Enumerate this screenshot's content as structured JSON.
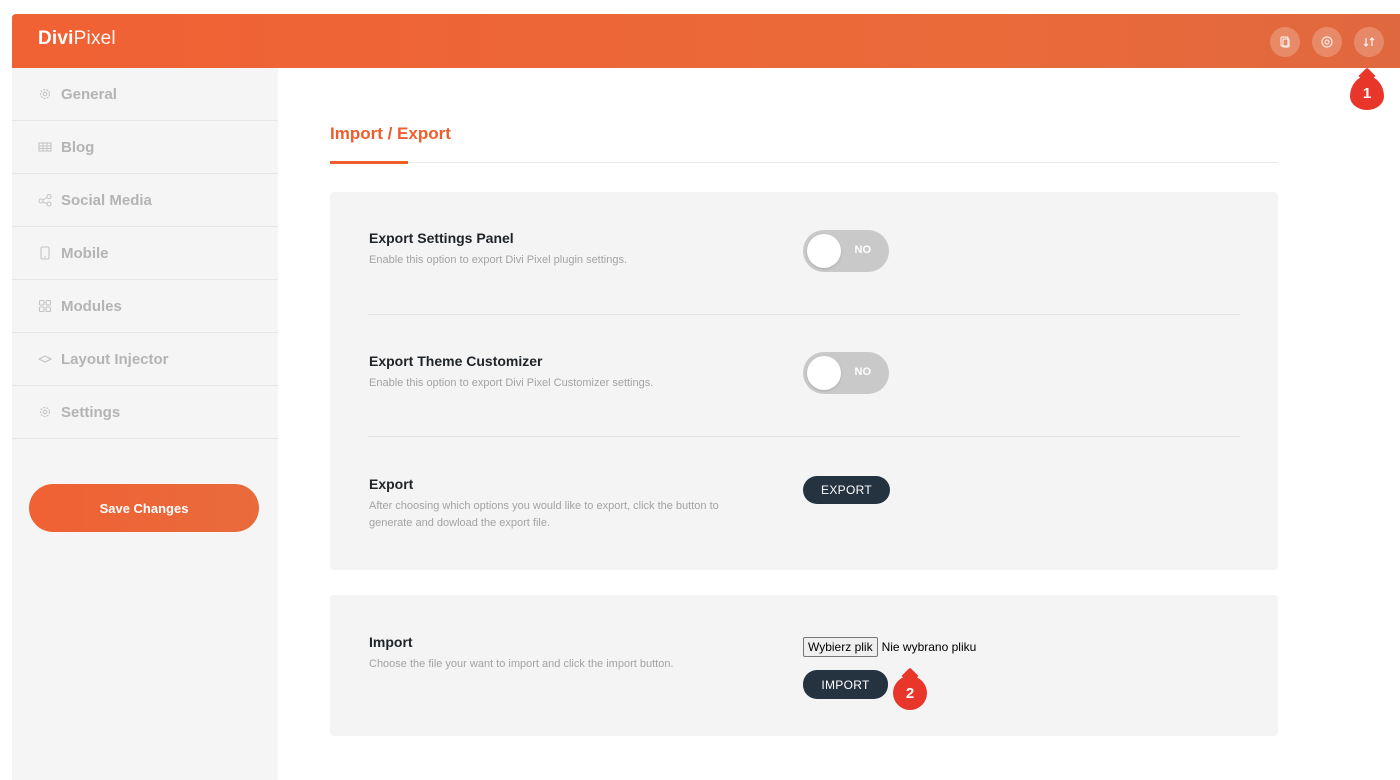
{
  "header": {
    "logo_mark": "Divi",
    "logo_light": "Pixel",
    "icons": [
      "document-icon",
      "support-icon",
      "import-export-icon"
    ]
  },
  "sidebar": {
    "items": [
      {
        "label": "General",
        "icon": "gear-icon"
      },
      {
        "label": "Blog",
        "icon": "grid-icon"
      },
      {
        "label": "Social Media",
        "icon": "share-icon"
      },
      {
        "label": "Mobile",
        "icon": "mobile-icon"
      },
      {
        "label": "Modules",
        "icon": "modules-icon"
      },
      {
        "label": "Layout Injector",
        "icon": "layers-icon"
      },
      {
        "label": "Settings",
        "icon": "settings-icon"
      }
    ],
    "save_label": "Save Changes"
  },
  "main": {
    "title": "Import / Export",
    "export_panel": {
      "settings_label": "Export Settings Panel",
      "settings_desc": "Enable this option to export Divi Pixel plugin settings.",
      "settings_toggle": "NO",
      "customizer_label": "Export Theme Customizer",
      "customizer_desc": "Enable this option to export Divi Pixel Customizer settings.",
      "customizer_toggle": "NO",
      "export_label": "Export",
      "export_desc": "After choosing which options you would like to export, click the button to generate and dowload the export file.",
      "export_button": "EXPORT"
    },
    "import_panel": {
      "label": "Import",
      "desc": "Choose the file your want to import and click the import button.",
      "file_button": "Wybierz plik",
      "file_status": "Nie wybrano pliku",
      "import_button": "IMPORT"
    }
  },
  "annotations": {
    "badge_1": "1",
    "badge_2": "2"
  },
  "colors": {
    "accent": "#ee5d2c",
    "dark_button": "#253341",
    "badge": "#e8362a"
  }
}
